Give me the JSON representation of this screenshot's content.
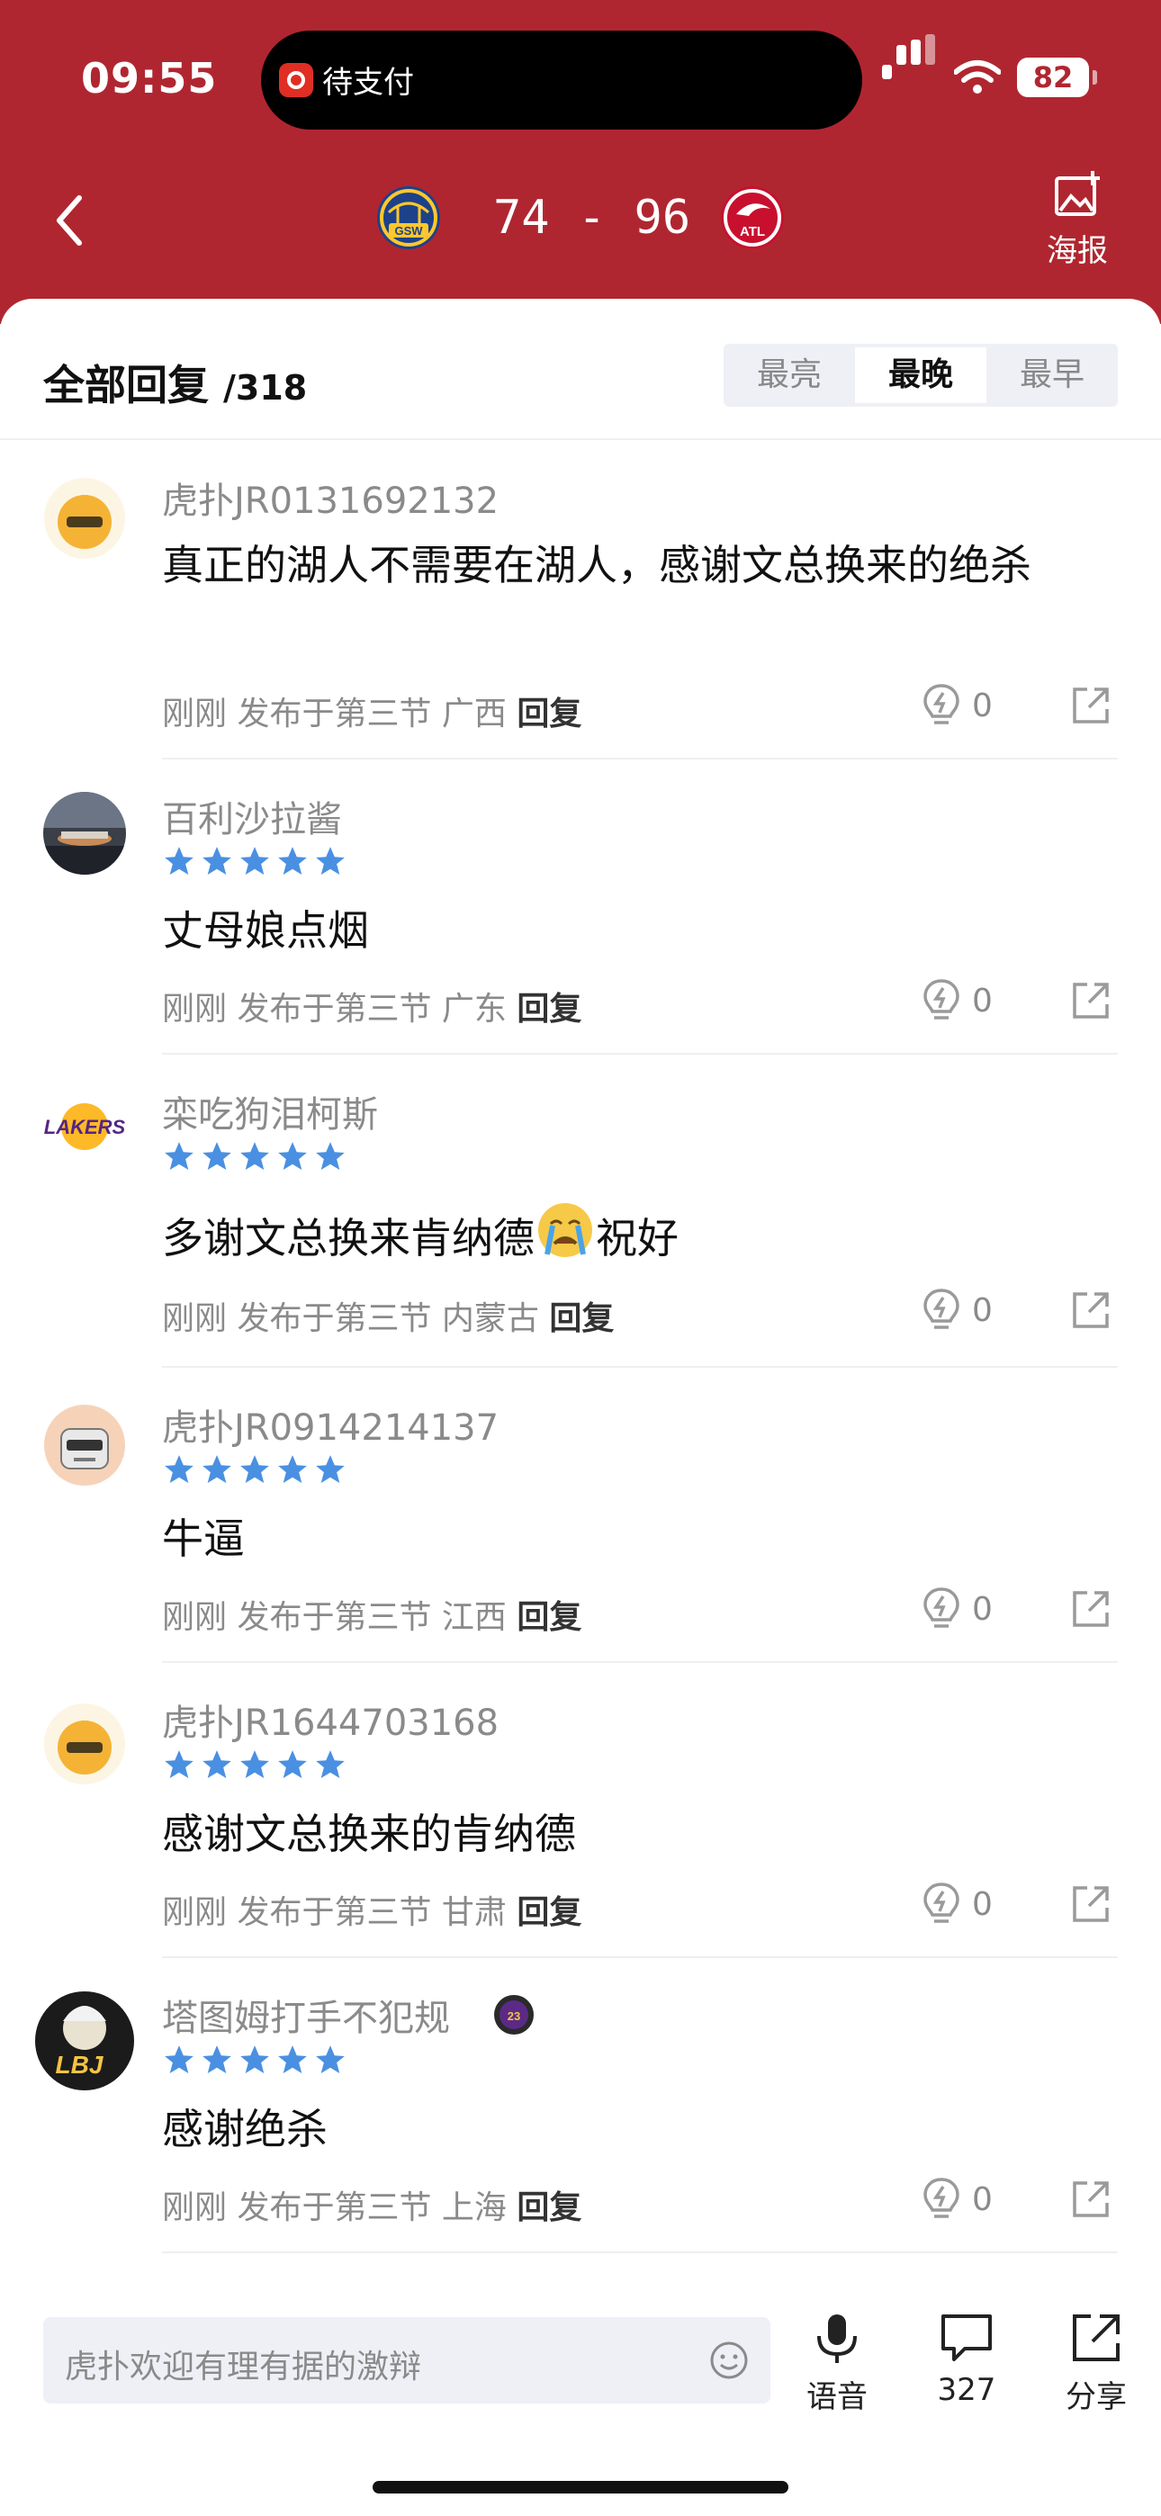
{
  "status_bar": {
    "time": "09:55",
    "island_app": "待支付",
    "battery": "82"
  },
  "game": {
    "score": "74 - 96",
    "home_team_icon": "gsw-logo-icon",
    "away_team_icon": "atl-logo-icon",
    "poster_label": "海报"
  },
  "section": {
    "title": "全部回复",
    "count": "/318"
  },
  "sort_tabs": [
    "最亮",
    "最晚",
    "最早"
  ],
  "active_sort": "最晚",
  "comments": [
    {
      "user": "虎扑JR0131692132",
      "rating": null,
      "text": "真正的湖人不需要在湖人，感谢文总换来的绝杀",
      "meta": "刚刚 发布于第三节 广西",
      "reply": "回复",
      "likes": "0",
      "avatar_icon": "hupu-default-avatar-icon"
    },
    {
      "user": "百利沙拉酱",
      "rating": 5,
      "text": "丈母娘点烟",
      "meta": "刚刚 发布于第三节 广东",
      "reply": "回复",
      "likes": "0",
      "avatar_icon": "photo-avatar-icon"
    },
    {
      "user": "栾吃狗泪柯斯",
      "rating": 5,
      "text": "多谢文总换来肯纳德",
      "emoji": "crying-face-emoji",
      "text_after": "祝好",
      "meta": "刚刚 发布于第三节 内蒙古",
      "reply": "回复",
      "likes": "0",
      "avatar_icon": "lakers-logo-avatar-icon"
    },
    {
      "user": "虎扑JR0914214137",
      "rating": 5,
      "text": "牛逼",
      "meta": "刚刚 发布于第三节 江西",
      "reply": "回复",
      "likes": "0",
      "avatar_icon": "robot-avatar-icon"
    },
    {
      "user": "虎扑JR1644703168",
      "rating": 5,
      "text": "感谢文总换来的肯纳德",
      "meta": "刚刚 发布于第三节 甘肃",
      "reply": "回复",
      "likes": "0",
      "avatar_icon": "hupu-default-avatar-icon"
    },
    {
      "user": "塔图姆打手不犯规",
      "rating": 5,
      "text": "感谢绝杀",
      "meta": "刚刚 发布于第三节 上海",
      "reply": "回复",
      "likes": "0",
      "avatar_icon": "lbj-avatar-icon",
      "badge_icon": "team-badge-icon"
    }
  ],
  "footer": {
    "input_placeholder": "虎扑欢迎有理有据的激辩",
    "voice_label": "语音",
    "comments_count": "327",
    "share_label": "分享"
  },
  "colors": {
    "header_red": "#b02630",
    "star_blue": "#4a90e2"
  }
}
